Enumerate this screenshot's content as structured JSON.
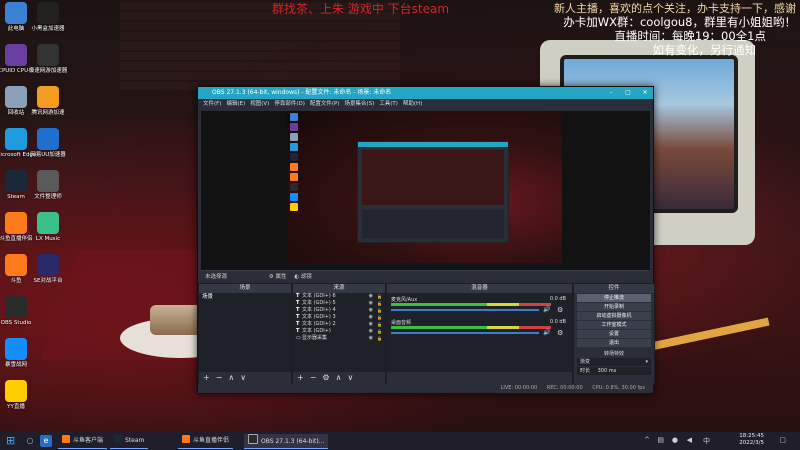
{
  "overlay": {
    "red_text": "群找茶、上朱 游戏中    下台steam",
    "line1": "新人主播，喜欢的点个关注，办卡支持一下，感谢",
    "line2": "办卡加WX群：coolgou8，群里有小姐姐哟！",
    "line3": "直播时间：每晚19：00全1点",
    "line4": "如有变化，另行通知"
  },
  "desktop_icons": [
    {
      "label": "此电脑",
      "icon": "computer-icon",
      "color": "#3b82d6"
    },
    {
      "label": "小黑盒加速器",
      "icon": "heybox-icon",
      "color": "#222222"
    },
    {
      "label": "CPUID CPU-Z",
      "icon": "cpuz-icon",
      "color": "#6b3fa0"
    },
    {
      "label": "极速网游加速器",
      "icon": "accelerator-icon",
      "color": "#333333"
    },
    {
      "label": "回收站",
      "icon": "recycle-bin-icon",
      "color": "#8aa0b8"
    },
    {
      "label": "腾讯网游加速",
      "icon": "tencent-accel-icon",
      "color": "#f39c1f"
    },
    {
      "label": "Microsoft Edge",
      "icon": "edge-icon",
      "color": "#1f9ce0"
    },
    {
      "label": "网易UU加速器",
      "icon": "uu-icon",
      "color": "#1f6fd0"
    },
    {
      "label": "Steam",
      "icon": "steam-icon",
      "color": "#1b2838"
    },
    {
      "label": "文件整理师",
      "icon": "file-icon",
      "color": "#5a5a5a"
    },
    {
      "label": "斗鱼直播伴侣",
      "icon": "douyu-icon",
      "color": "#ff7a1a"
    },
    {
      "label": "LX Music",
      "icon": "lxmusic-icon",
      "color": "#3cc08a"
    },
    {
      "label": "斗鱼",
      "icon": "douyu-app-icon",
      "color": "#ff7a1a"
    },
    {
      "label": "SE对战平台",
      "icon": "se-icon",
      "color": "#2a2a6a"
    },
    {
      "label": "OBS Studio",
      "icon": "obs-icon",
      "color": "#2a2a2a"
    },
    {
      "label": "暴雪战网",
      "icon": "battlenet-icon",
      "color": "#148eff"
    },
    {
      "label": "YY直播",
      "icon": "yy-icon",
      "color": "#ffcc00"
    }
  ],
  "obs": {
    "title": "OBS 27.1.3 (64-bit, windows) - 配置文件: 未命名 - 场景: 未命名",
    "menu": [
      "文件(F)",
      "编辑(E)",
      "视图(V)",
      "停靠部件(D)",
      "配置文件(P)",
      "场景集合(S)",
      "工具(T)",
      "帮助(H)"
    ],
    "source_bar": {
      "label": "未选择源",
      "props": "属性",
      "filters": "滤镜"
    },
    "scenes": {
      "title": "场景",
      "items": [
        "场景"
      ]
    },
    "sources": {
      "title": "来源",
      "items": [
        "文本 (GDI+) 6",
        "文本 (GDI+) 5",
        "文本 (GDI+) 4",
        "文本 (GDI+) 3",
        "文本 (GDI+) 2",
        "文本 (GDI+)",
        "显示器采集"
      ]
    },
    "mixer": {
      "title": "混音器",
      "tracks": [
        {
          "name": "麦克风/Aux",
          "db": "0.0 dB"
        },
        {
          "name": "桌面音频",
          "db": "0.0 dB"
        }
      ]
    },
    "controls": {
      "title": "控件",
      "buttons": [
        "停止推流",
        "开始录制",
        "启动虚拟摄像机",
        "工作室模式",
        "设置",
        "退出"
      ],
      "transitions_title": "转场特效",
      "transition": "渐变",
      "duration_label": "时长",
      "duration": "300 ms"
    },
    "status": {
      "live": "LIVE: 00:00:00",
      "rec": "REC: 00:00:00",
      "cpu": "CPU: 0.8%, 30.00 fps"
    }
  },
  "taskbar": {
    "items": [
      "斗鱼客户端",
      "Steam",
      "斗鱼直播伴侣",
      "OBS 27.1.3 (64-bit)..."
    ],
    "time": "18:25:45",
    "date": "2022/3/5",
    "ime": "中"
  }
}
